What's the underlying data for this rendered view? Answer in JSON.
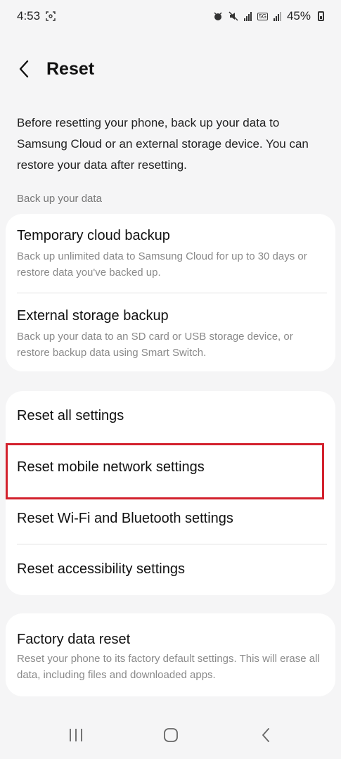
{
  "status_bar": {
    "time": "4:53",
    "battery_percent": "45%",
    "network_badge": "5G"
  },
  "header": {
    "title": "Reset"
  },
  "intro_text": "Before resetting your phone, back up your data to Samsung Cloud or an external storage device. You can restore your data after resetting.",
  "backup_section": {
    "label": "Back up your data",
    "items": [
      {
        "title": "Temporary cloud backup",
        "subtitle": "Back up unlimited data to Samsung Cloud for up to 30 days or restore data you've backed up."
      },
      {
        "title": "External storage backup",
        "subtitle": "Back up your data to an SD card or USB storage device, or restore backup data using Smart Switch."
      }
    ]
  },
  "reset_section": {
    "items": [
      {
        "title": "Reset all settings"
      },
      {
        "title": "Reset mobile network settings"
      },
      {
        "title": "Reset Wi-Fi and Bluetooth settings"
      },
      {
        "title": "Reset accessibility settings"
      }
    ]
  },
  "factory_section": {
    "title": "Factory data reset",
    "subtitle": "Reset your phone to its factory default settings. This will erase all data, including files and downloaded apps."
  },
  "colors": {
    "highlight": "#d3212d",
    "background": "#f5f5f6",
    "card": "#ffffff"
  }
}
